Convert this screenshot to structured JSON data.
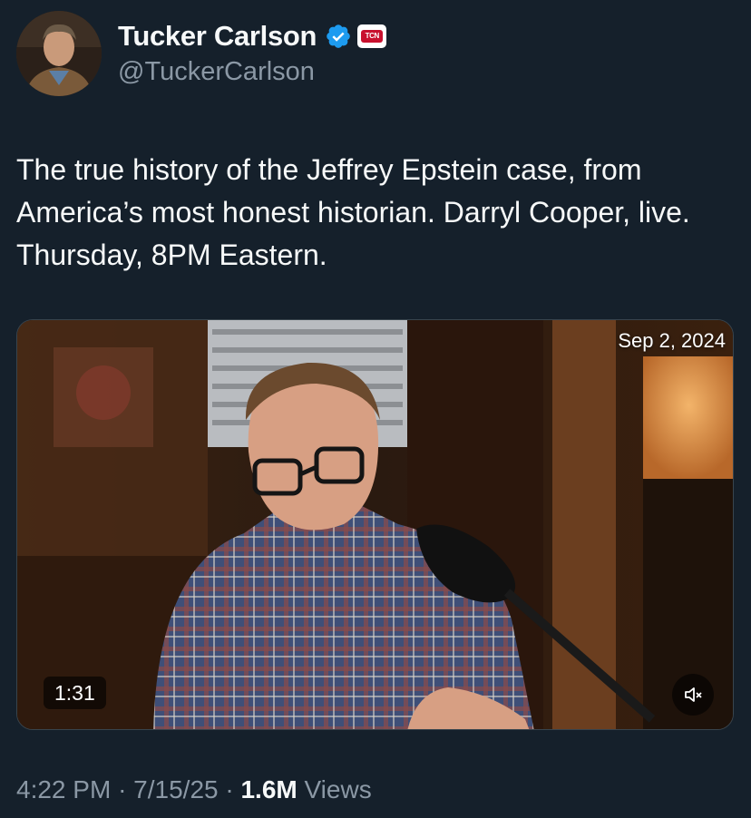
{
  "author": {
    "display_name": "Tucker Carlson",
    "handle": "@TuckerCarlson",
    "affiliation_badge": "TCN",
    "verified_icon": "verified-badge-icon",
    "verified_color": "#1d9bf0"
  },
  "tweet": {
    "text": "The true history of the Jeffrey Epstein case, from America’s most honest historian. Darryl Cooper, live. Thursday, 8PM Eastern."
  },
  "video": {
    "date_overlay": "Sep 2, 2024",
    "duration": "1:31",
    "mute_icon": "speaker-muted-icon"
  },
  "meta": {
    "time": "4:22 PM",
    "separator": "·",
    "date": "7/15/25",
    "views_count": "1.6M",
    "views_label": "Views"
  },
  "colors": {
    "background": "#15202b",
    "text_primary": "#f7f9f9",
    "text_secondary": "#8b98a5"
  }
}
